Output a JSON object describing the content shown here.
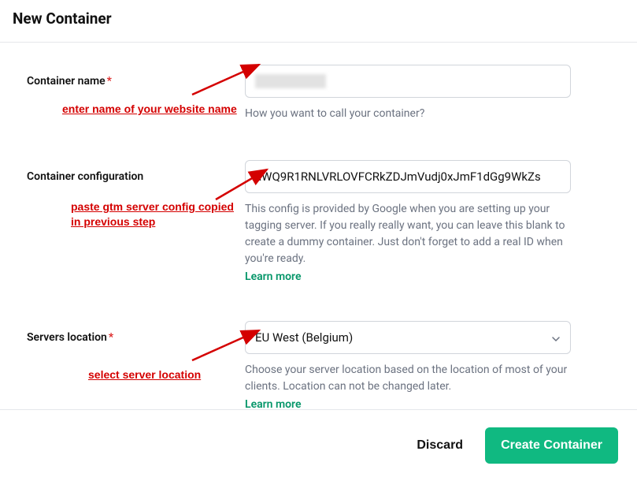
{
  "header": {
    "title": "New Container"
  },
  "fields": {
    "name": {
      "label": "Container name",
      "required": true,
      "value": "",
      "helper": "How you want to call your container?"
    },
    "config": {
      "label": "Container configuration",
      "required": false,
      "value": "aWQ9R1RNLVRLOVFCRkZDJmVudj0xJmF1dGg9WkZs",
      "helper": "This config is provided by Google when you are setting up your tagging server. If you really really want, you can leave this blank to create a dummy container. Just don't forget to add a real ID when you're ready.",
      "learn_more": "Learn more"
    },
    "location": {
      "label": "Servers location",
      "required": true,
      "value": "EU West (Belgium)",
      "helper": "Choose your server location based on the location of most of your clients. Location can not be changed later.",
      "learn_more": "Learn more"
    }
  },
  "annotations": {
    "name": "enter name of your website name",
    "config_line1": "paste gtm server config copied",
    "config_line2": "in previous step",
    "location": "select server location"
  },
  "footer": {
    "discard": "Discard",
    "create": "Create Container"
  }
}
